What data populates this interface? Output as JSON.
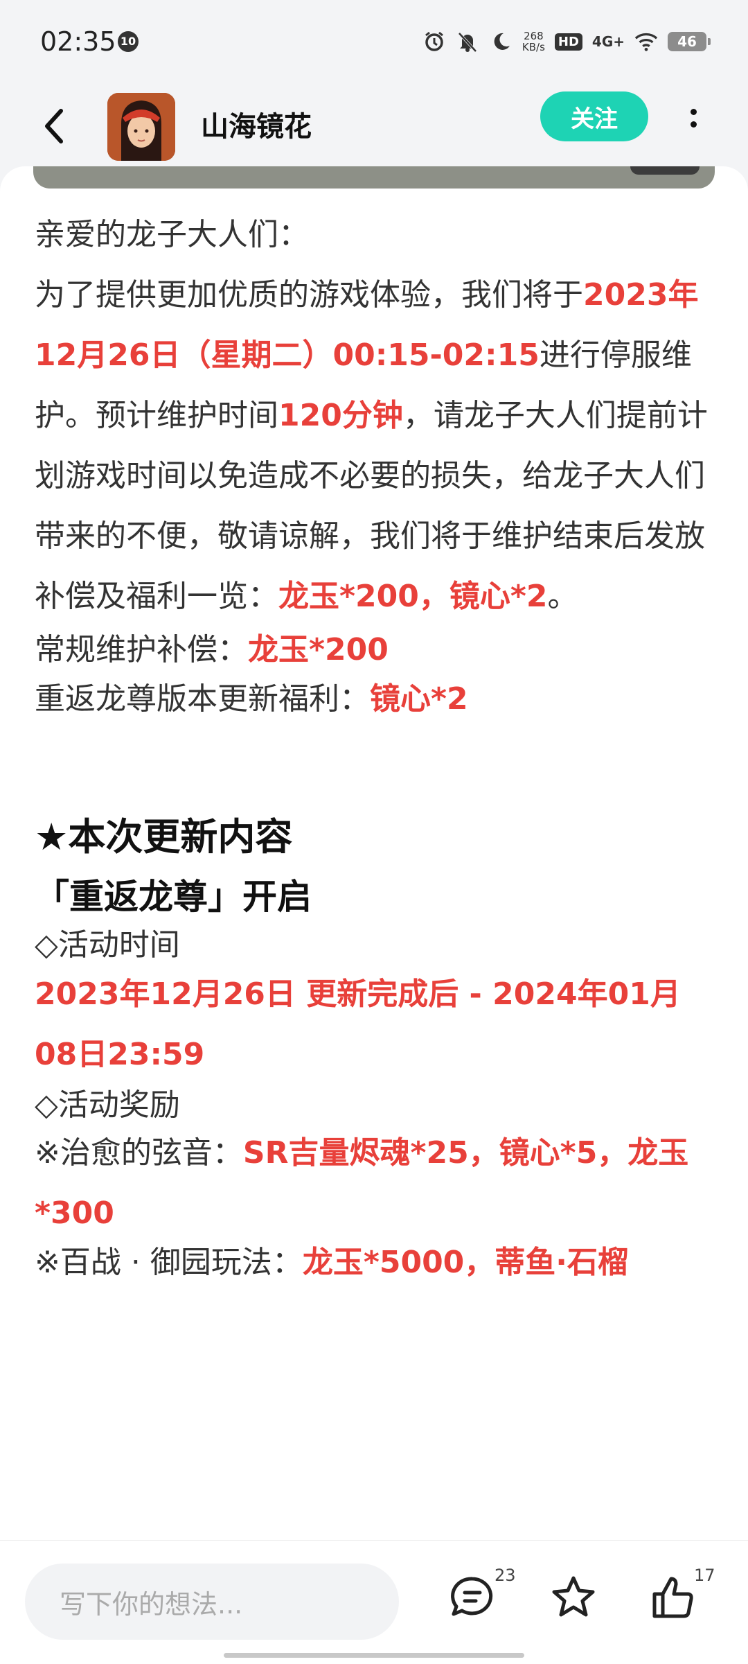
{
  "status_bar": {
    "time": "02:35",
    "notif_count": "10",
    "speed_value": "268",
    "speed_unit": "KB/s",
    "hd": "HD",
    "network": "4G+",
    "battery": "46"
  },
  "header": {
    "title": "山海镜花",
    "follow_label": "关注"
  },
  "post": {
    "greeting": "亲爱的龙子大人们：",
    "p1_a": "为了提供更加优质的游戏体验，我们将于",
    "p1_b": "2023年12月26日（星期二）00:15-02:15",
    "p1_c": "进行停服维护。预计维护时间",
    "p1_d": "120分钟",
    "p1_e": "，请龙子大人们提前计划游戏时间以免造成不必要的损失，给龙子大人们带来的不便，敬请谅解，我们将于维护结束后发放补偿及福利一览：",
    "p1_f": "龙玉*200，镜心*2",
    "p1_g": "。",
    "comp_label": "常规维护补偿：",
    "comp_value": "龙玉*200",
    "bonus_label": "重返龙尊版本更新福利：",
    "bonus_value": "镜心*2",
    "section_title": "★本次更新内容",
    "event_title": "「重返龙尊」开启",
    "time_label": "◇活动时间",
    "time_value": "2023年12月26日 更新完成后 - 2024年01月08日23:59",
    "reward_label": "◇活动奖励",
    "reward1_label": "※治愈的弦音：",
    "reward1_value": "SR吉量烬魂*25，镜心*5，龙玉*300",
    "reward2_label": "※百战 · 御园玩法：",
    "reward2_value": "龙玉*5000，蒂鱼·石榴"
  },
  "bottom_bar": {
    "comment_placeholder": "写下你的想法...",
    "comment_count": "23",
    "like_count": "17"
  }
}
